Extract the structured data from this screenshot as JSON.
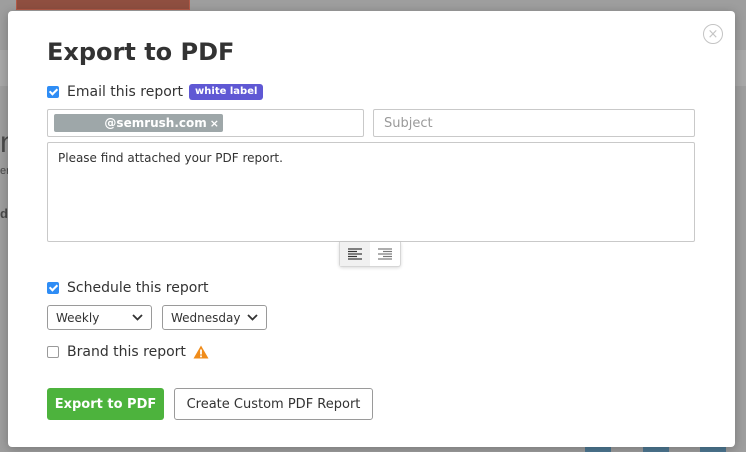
{
  "background": {
    "fragments": [
      "n",
      "er",
      "d"
    ]
  },
  "modal": {
    "title": "Export to PDF",
    "close_glyph": "×",
    "email": {
      "label": "Email this report",
      "checked": true,
      "badge": "white label",
      "chip_text": "@semrush.com",
      "chip_remove": "×",
      "subject_placeholder": "Subject",
      "message": "Please find attached your PDF report."
    },
    "schedule": {
      "label": "Schedule this report",
      "checked": true,
      "frequency": "Weekly",
      "day": "Wednesday"
    },
    "brand": {
      "label": "Brand this report",
      "checked": false
    },
    "buttons": {
      "export": "Export to PDF",
      "custom": "Create Custom PDF Report"
    }
  },
  "colors": {
    "accent_blue": "#2f8df5",
    "badge_purple": "#5f58d4",
    "export_green": "#4db33d",
    "warning_orange": "#f08c1a"
  },
  "icons": {
    "close": "close-circle-icon",
    "warning": "warning-triangle-icon",
    "align_left": "align-left-icon",
    "align_right": "align-right-icon",
    "dropdown": "chevron-down-icon"
  }
}
